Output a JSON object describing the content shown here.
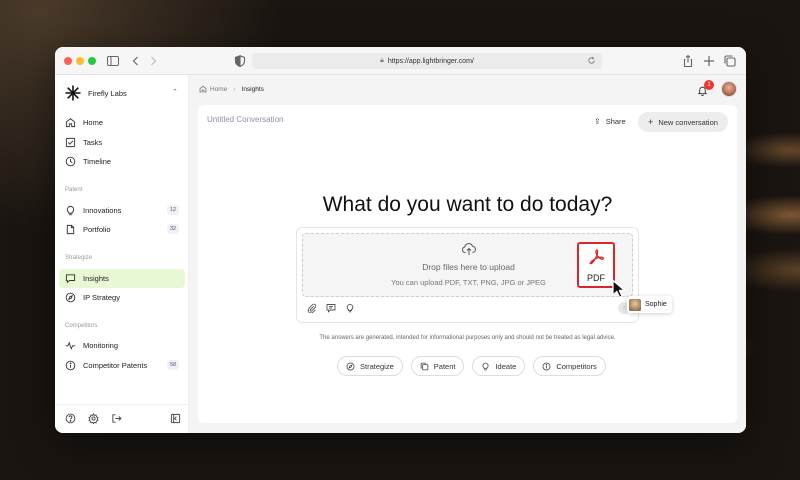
{
  "browser": {
    "url": "https://app.lightbringer.com/"
  },
  "sidebar": {
    "org_name": "Firefly Labs",
    "top_items": [
      {
        "label": "Home",
        "icon": "home-icon"
      },
      {
        "label": "Tasks",
        "icon": "checkbox-icon"
      },
      {
        "label": "Timeline",
        "icon": "clock-icon"
      }
    ],
    "sections": [
      {
        "title": "Patent",
        "items": [
          {
            "label": "Innovations",
            "badge": "12",
            "icon": "lightbulb-icon"
          },
          {
            "label": "Portfolio",
            "badge": "32",
            "icon": "document-icon"
          }
        ]
      },
      {
        "title": "Strategize",
        "items": [
          {
            "label": "Insights",
            "icon": "chat-icon",
            "active": true
          },
          {
            "label": "IP Strategy",
            "icon": "compass-icon"
          }
        ]
      },
      {
        "title": "Competitors",
        "items": [
          {
            "label": "Monitoring",
            "icon": "pulse-icon"
          },
          {
            "label": "Competitor Patents",
            "badge": "58",
            "icon": "info-circle-icon"
          }
        ]
      }
    ]
  },
  "header": {
    "breadcrumb": [
      "Home",
      "Insights"
    ],
    "notification_count": "1"
  },
  "conversation": {
    "title": "Untitled Conversation",
    "share_label": "Share",
    "new_conversation_label": "New conversation",
    "headline": "What do you want to do today?",
    "drop_title": "Drop files here to upload",
    "drop_subtitle": "You can upload PDF, TXT, PNG, JPG or JPEG",
    "dragged_file_label": "PDF",
    "collaborator_name": "Sophie",
    "disclaimer": "The answers are generated, intended for informational purposes only and should not be treated as legal advice.",
    "chips": [
      {
        "label": "Strategize",
        "icon": "compass-icon"
      },
      {
        "label": "Patent",
        "icon": "gallery-icon"
      },
      {
        "label": "Ideate",
        "icon": "lightbulb-icon"
      },
      {
        "label": "Competitors",
        "icon": "info-circle-icon"
      }
    ]
  },
  "colors": {
    "accent_active_bg": "#e6f9d4",
    "pdf_red": "#d8262b",
    "notification_red": "#e33"
  }
}
